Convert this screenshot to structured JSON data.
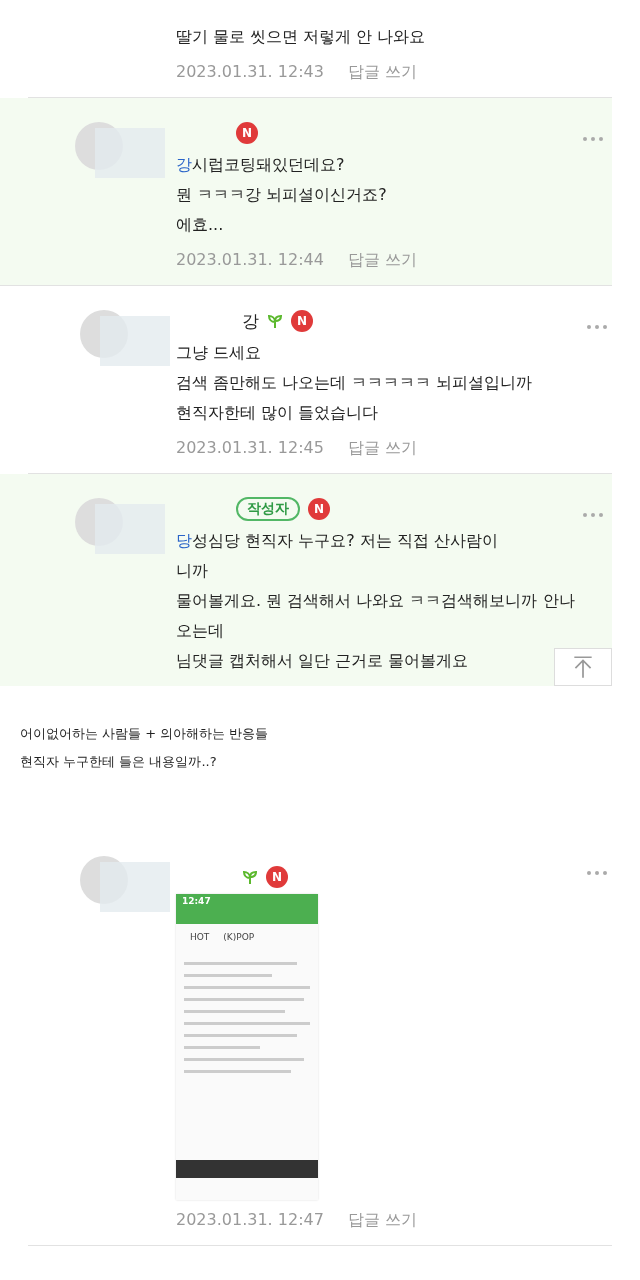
{
  "comments": [
    {
      "kind": "partial",
      "highlighted": false,
      "lines": [
        "딸기 물로 씻으면 저렇게 안 나와요"
      ],
      "date": "2023.01.31. 12:43",
      "reply": "답글 쓰기"
    },
    {
      "kind": "full",
      "highlighted": true,
      "mention": "강",
      "badges": [
        {
          "kind": "new",
          "text": "N"
        }
      ],
      "lines": [
        "시럽코팅돼있던데요?",
        "뭔 ㅋㅋㅋ강 뇌피셜이신거죠?",
        "에효..."
      ],
      "date": "2023.01.31. 12:44",
      "reply": "답글 쓰기"
    },
    {
      "kind": "full",
      "highlighted": false,
      "nickname": "강",
      "badges": [
        {
          "kind": "sprout"
        },
        {
          "kind": "new",
          "text": "N"
        }
      ],
      "lines": [
        "그냥 드세요",
        "검색 좀만해도 나오는데 ㅋㅋㅋㅋㅋ 뇌피셜입니까",
        "현직자한테 많이 들었습니다"
      ],
      "date": "2023.01.31. 12:45",
      "reply": "답글 쓰기"
    },
    {
      "kind": "full",
      "highlighted": true,
      "mention": "당",
      "badges": [
        {
          "kind": "author",
          "text": "작성자"
        },
        {
          "kind": "new",
          "text": "N"
        }
      ],
      "lines": [
        "성심당 현직자 누구요? 저는 직접 산사람이",
        "니까",
        "물어볼게요. 뭔 검색해서 나와요 ㅋㅋ검색해보니까 안나",
        "오는데",
        "님댓글 캡처해서 일단 근거로 물어볼게요"
      ]
    }
  ],
  "caption": [
    "어이없어하는 사람들 + 의아해하는 반응들",
    "현직자 누구한테 들은 내용일까..?"
  ],
  "last_comment": {
    "kind": "full",
    "highlighted": false,
    "badges": [
      {
        "kind": "sprout"
      },
      {
        "kind": "new",
        "text": "N"
      }
    ],
    "image": true,
    "image_time": "12:47",
    "image_tabs": [
      "HOT",
      "(K)POP"
    ],
    "date": "2023.01.31. 12:47",
    "reply": "답글 쓰기"
  }
}
